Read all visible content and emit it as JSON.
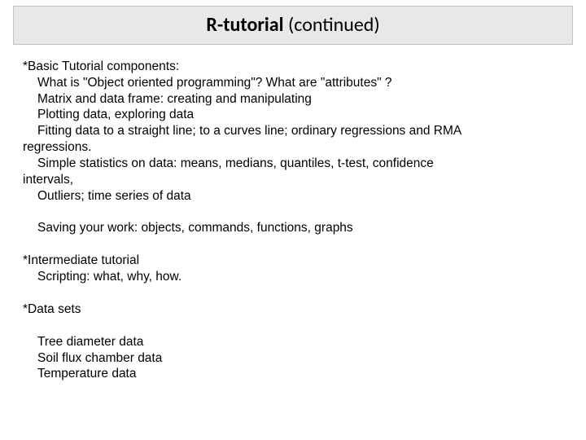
{
  "title": {
    "bold": "R-tutorial",
    "rest": " (continued)"
  },
  "body": {
    "l1": "*Basic Tutorial components:",
    "l2": "What is \"Object oriented programming\"? What are \"attributes\" ?",
    "l3": "Matrix and data frame:  creating and manipulating",
    "l4": "Plotting data, exploring data",
    "l5": "Fitting data to a straight line; to a curves line; ordinary regressions and RMA",
    "l6": "regressions.",
    "l7": "Simple statistics on data: means, medians, quantiles, t-test, confidence",
    "l8": "intervals,",
    "l9": "Outliers; time series of data",
    "l10": "Saving your work:  objects, commands, functions, graphs",
    "l11": "*Intermediate tutorial",
    "l12": "Scripting:  what, why, how.",
    "l13": "*Data sets",
    "l14": "Tree diameter data",
    "l15": "Soil flux chamber data",
    "l16": "Temperature data"
  }
}
